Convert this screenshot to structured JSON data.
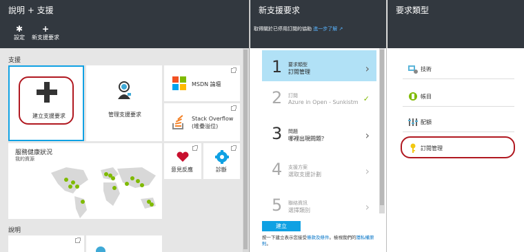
{
  "blade1": {
    "title": "說明 + 支援",
    "toolbar": {
      "settings_label": "設定",
      "new_request_label": "新支援要求"
    },
    "section_support": "支援",
    "tiles": {
      "create_request": "建立支援要求",
      "manage_requests": "管理支援要求",
      "msdn": "MSDN 論壇",
      "stack_overflow": "Stack Overflow\n(堆疊溢位)",
      "health_title": "服務健康狀況",
      "health_subtitle": "我的資源",
      "feedback": "意見反應",
      "diagnostics": "診斷"
    },
    "section_help": "說明"
  },
  "blade2": {
    "title": "新支援要求",
    "subtitle": "取得關於已停用訂閱的協助",
    "subtitle_link": "進一步了解",
    "steps": [
      {
        "num": "1",
        "title": "要求類型",
        "value": "訂閱管理"
      },
      {
        "num": "2",
        "title": "訂閱",
        "value": "Azure in Open - Sunkistm"
      },
      {
        "num": "3",
        "title": "問題",
        "value": "哪裡出現問題？"
      },
      {
        "num": "4",
        "title": "支援方案",
        "value": "選取支援計劃"
      },
      {
        "num": "5",
        "title": "聯絡資訊",
        "value": "選擇類別"
      }
    ],
    "create_label": "建立",
    "terms_prefix": "按一下建立表示您接受",
    "terms_link": "條款及條件",
    "terms_mid": "。檢視我們的",
    "privacy_link": "隱私權原則",
    "terms_suffix": "。"
  },
  "blade3": {
    "title": "要求類型",
    "types": [
      {
        "label": "技術",
        "icon": "technical-icon"
      },
      {
        "label": "帳目",
        "icon": "billing-icon"
      },
      {
        "label": "配額",
        "icon": "quota-icon"
      },
      {
        "label": "訂閱管理",
        "icon": "key-icon"
      }
    ]
  },
  "colors": {
    "header_bg": "#32383f",
    "accent_blue": "#0fa1e3",
    "selected_step": "#b1e1f6",
    "highlight_red": "#b0171f",
    "check_green": "#7fba00"
  }
}
